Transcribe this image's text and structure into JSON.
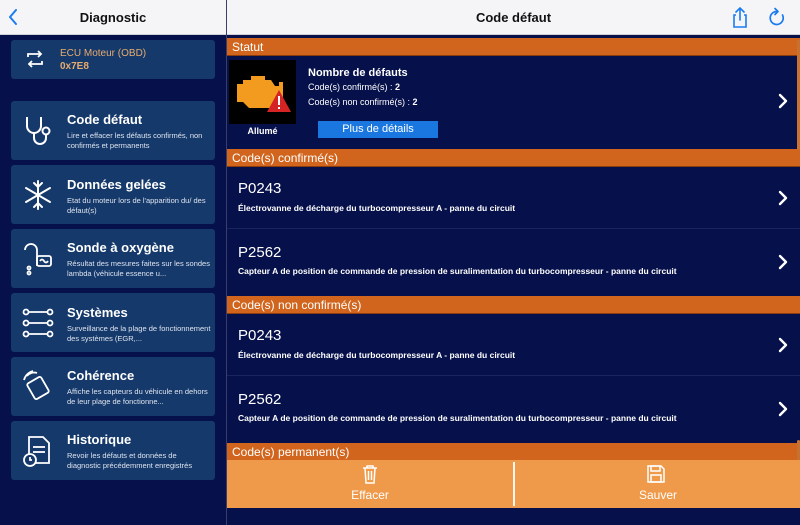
{
  "sidebar_header": {
    "title": "Diagnostic"
  },
  "main_header": {
    "title": "Code défaut"
  },
  "ecu": {
    "name": "ECU Moteur (OBD)",
    "address": "0x7E8"
  },
  "sidebar": {
    "items": [
      {
        "title": "Code défaut",
        "desc": "Lire et effacer les défauts confirmés, non confirmés et permanents",
        "icon": "stethoscope-icon"
      },
      {
        "title": "Données gelées",
        "desc": "Etat du moteur lors de l'apparition du/ des défaut(s)",
        "icon": "snowflake-icon"
      },
      {
        "title": "Sonde à oxygène",
        "desc": "Résultat des mesures faites sur les sondes lambda (véhicule essence u...",
        "icon": "oxygen-sensor-icon"
      },
      {
        "title": "Systèmes",
        "desc": "Surveillance de la plage de fonctionnement des systèmes (EGR,...",
        "icon": "systems-icon"
      },
      {
        "title": "Cohérence",
        "desc": "Affiche les capteurs du véhicule en dehors de leur plage de fonctionne...",
        "icon": "coherence-icon"
      },
      {
        "title": "Historique",
        "desc": "Revoir les défauts et données de diagnostic précédemment enregistrés",
        "icon": "history-icon"
      }
    ]
  },
  "status": {
    "header": "Statut",
    "lamp_label": "Allumé",
    "title": "Nombre de défauts",
    "confirmed_text": "Code(s) confirmé(s) : ",
    "confirmed_count": "2",
    "unconfirmed_text": "Code(s) non confirmé(s) : ",
    "unconfirmed_count": "2",
    "details_button": "Plus de détails"
  },
  "confirmed": {
    "header": "Code(s) confirmé(s)",
    "codes": [
      {
        "code": "P0243",
        "desc": "Électrovanne de décharge du turbocompresseur A - panne du circuit"
      },
      {
        "code": "P2562",
        "desc": "Capteur A de position de commande de pression de suralimentation du turbocompresseur - panne du circuit"
      }
    ]
  },
  "unconfirmed": {
    "header": "Code(s) non confirmé(s)",
    "codes": [
      {
        "code": "P0243",
        "desc": "Électrovanne de décharge du turbocompresseur A - panne du circuit"
      },
      {
        "code": "P2562",
        "desc": "Capteur A de position de commande de pression de suralimentation du turbocompresseur - panne du circuit"
      }
    ]
  },
  "permanent": {
    "header": "Code(s) permanent(s)"
  },
  "toolbar": {
    "clear_label": "Effacer",
    "save_label": "Sauver"
  },
  "colors": {
    "accent_orange": "#d1651e",
    "toolbar_orange": "#ef9a4a",
    "card_blue": "#15396a",
    "background_navy": "#06104a",
    "link_blue": "#1a77e0",
    "ecu_text": "#e8ac6e"
  }
}
